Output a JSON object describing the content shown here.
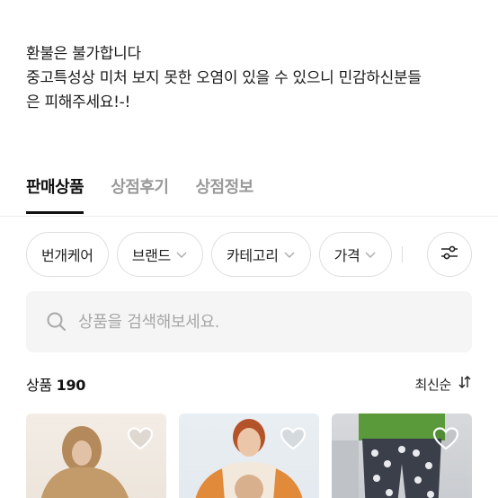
{
  "notice": {
    "line1": "환불은 불가합니다",
    "line2": "중고특성상 미처 보지 못한 오염이 있을 수 있으니 민감하신분들",
    "line3": "은 피해주세요!-!"
  },
  "tabs": [
    {
      "label": "판매상품",
      "active": true
    },
    {
      "label": "상점후기",
      "active": false
    },
    {
      "label": "상점정보",
      "active": false
    }
  ],
  "filters": [
    {
      "label": "번개케어",
      "has_dropdown": false
    },
    {
      "label": "브랜드",
      "has_dropdown": true
    },
    {
      "label": "카테고리",
      "has_dropdown": true
    },
    {
      "label": "가격",
      "has_dropdown": true
    }
  ],
  "search": {
    "placeholder": "상품을 검색해보세요.",
    "value": ""
  },
  "count": {
    "label": "상품",
    "value": "190"
  },
  "sort": {
    "label": "최신순"
  },
  "colors": {
    "accent": "#111111",
    "muted": "#9a9a9a",
    "chip_border": "#dedede",
    "search_bg": "#f5f5f5"
  },
  "icons": [
    "chevron-down-icon",
    "sliders-icon",
    "search-icon",
    "sort-icon",
    "heart-outline-icon"
  ]
}
